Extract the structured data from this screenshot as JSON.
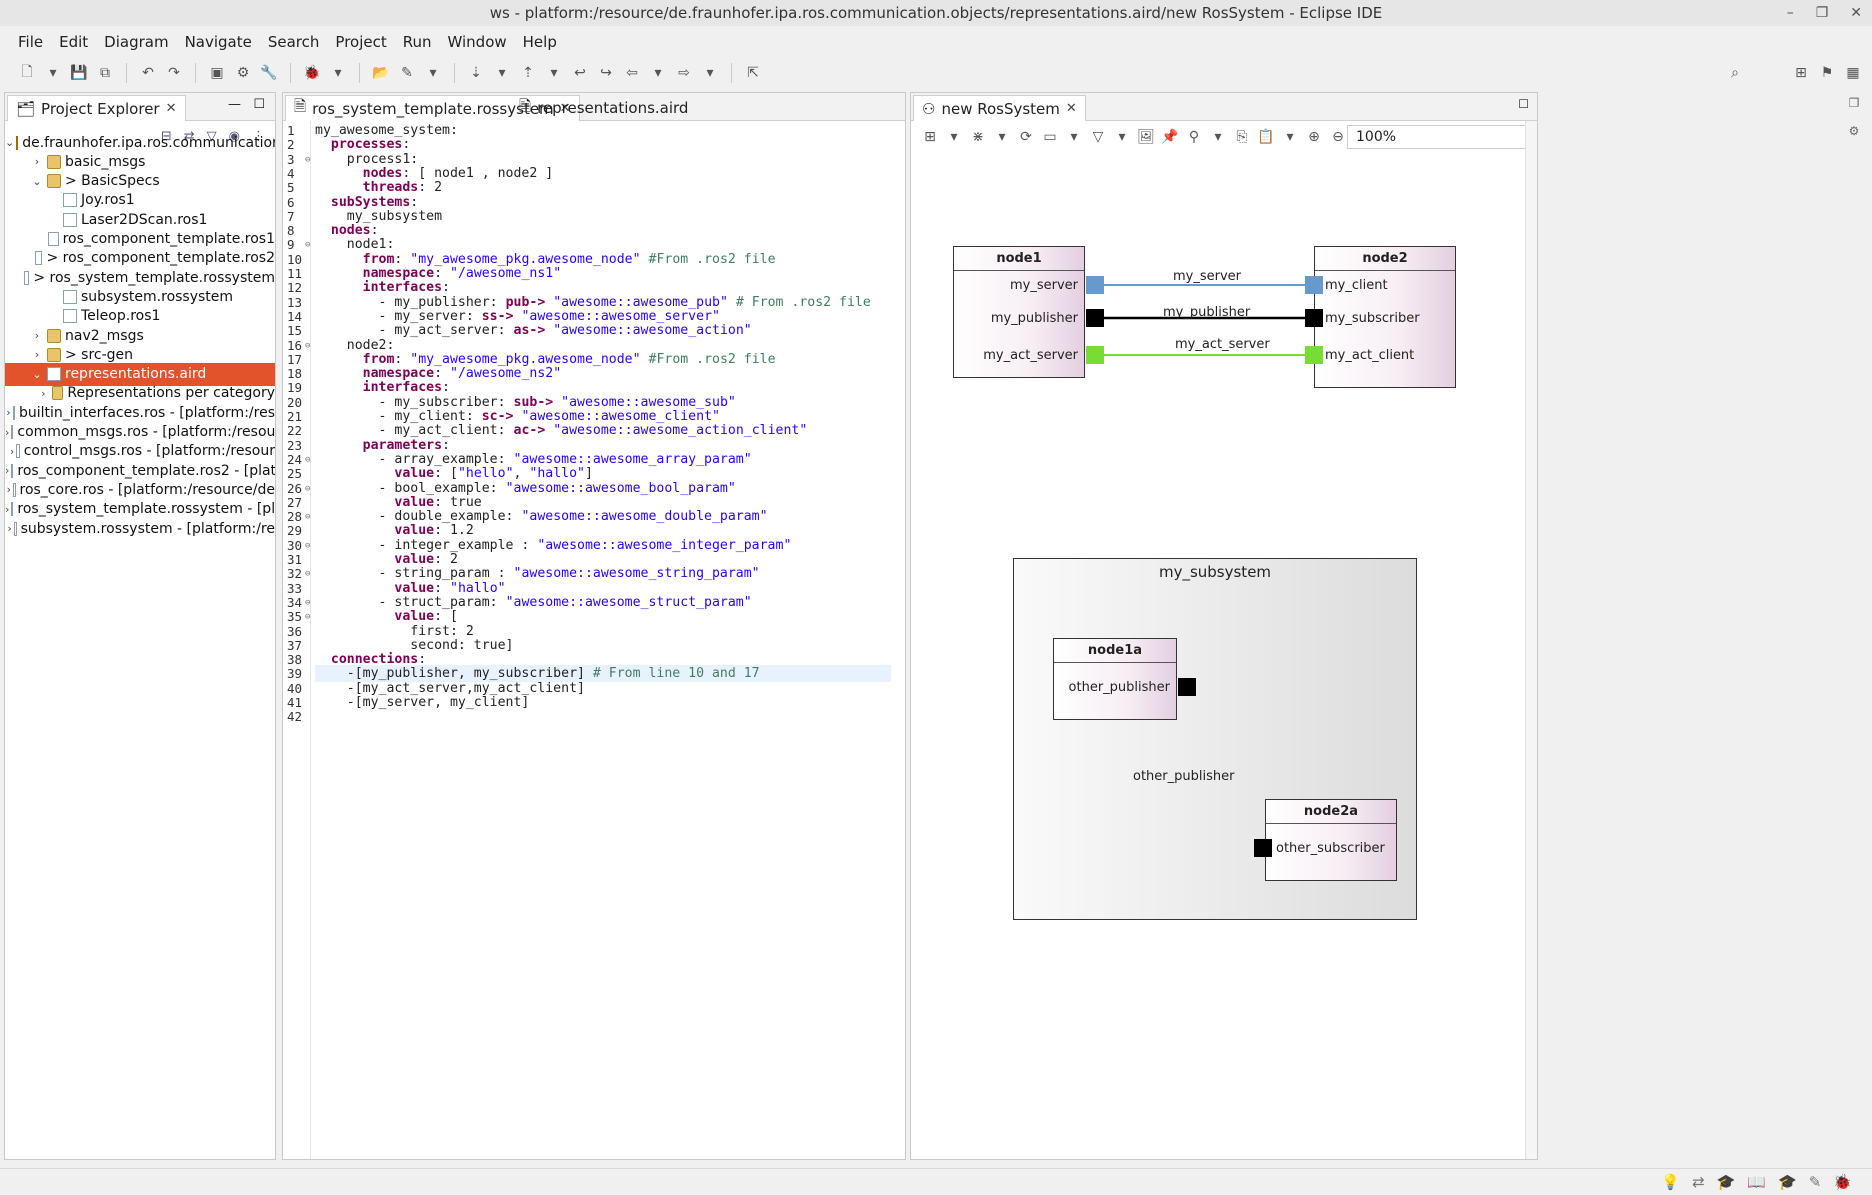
{
  "window": {
    "title": "ws - platform:/resource/de.fraunhofer.ipa.ros.communication.objects/representations.aird/new RosSystem - Eclipse IDE"
  },
  "menu": [
    "File",
    "Edit",
    "Diagram",
    "Navigate",
    "Search",
    "Project",
    "Run",
    "Window",
    "Help"
  ],
  "explorer": {
    "title": "Project Explorer",
    "items": [
      {
        "label": "de.fraunhofer.ipa.ros.communication.ob",
        "depth": 0,
        "twisty": "open",
        "icon": "proj"
      },
      {
        "label": "basic_msgs",
        "depth": 1,
        "twisty": "closed",
        "icon": "folder"
      },
      {
        "label": "> BasicSpecs",
        "depth": 1,
        "twisty": "open",
        "icon": "folder"
      },
      {
        "label": "Joy.ros1",
        "depth": 2,
        "twisty": "",
        "icon": "file"
      },
      {
        "label": "Laser2DScan.ros1",
        "depth": 2,
        "twisty": "",
        "icon": "file"
      },
      {
        "label": "ros_component_template.ros1",
        "depth": 2,
        "twisty": "",
        "icon": "file"
      },
      {
        "label": "> ros_component_template.ros2",
        "depth": 2,
        "twisty": "",
        "icon": "file"
      },
      {
        "label": "> ros_system_template.rossystem",
        "depth": 2,
        "twisty": "",
        "icon": "file"
      },
      {
        "label": "subsystem.rossystem",
        "depth": 2,
        "twisty": "",
        "icon": "file"
      },
      {
        "label": "Teleop.ros1",
        "depth": 2,
        "twisty": "",
        "icon": "file"
      },
      {
        "label": "nav2_msgs",
        "depth": 1,
        "twisty": "closed",
        "icon": "folder"
      },
      {
        "label": "> src-gen",
        "depth": 1,
        "twisty": "closed",
        "icon": "folder"
      },
      {
        "label": "representations.aird",
        "depth": 1,
        "twisty": "open",
        "icon": "file",
        "selected": true
      },
      {
        "label": "Representations per category",
        "depth": 2,
        "twisty": "closed",
        "icon": "folder"
      },
      {
        "label": "builtin_interfaces.ros - [platform:/res",
        "depth": 2,
        "twisty": "closed",
        "icon": "file"
      },
      {
        "label": "common_msgs.ros - [platform:/resou",
        "depth": 2,
        "twisty": "closed",
        "icon": "file"
      },
      {
        "label": "control_msgs.ros - [platform:/resour",
        "depth": 2,
        "twisty": "closed",
        "icon": "file"
      },
      {
        "label": "ros_component_template.ros2 - [plat",
        "depth": 2,
        "twisty": "closed",
        "icon": "file"
      },
      {
        "label": "ros_core.ros - [platform:/resource/de",
        "depth": 2,
        "twisty": "closed",
        "icon": "file"
      },
      {
        "label": "ros_system_template.rossystem - [pl",
        "depth": 2,
        "twisty": "closed",
        "icon": "file"
      },
      {
        "label": "subsystem.rossystem - [platform:/re",
        "depth": 2,
        "twisty": "closed",
        "icon": "file"
      }
    ]
  },
  "editor": {
    "tabs": [
      "ros_system_template.rossystem",
      "representations.aird"
    ],
    "lines": [
      "my_awesome_system:",
      "  processes:",
      "    process1:",
      "      nodes: [ node1 , node2 ]",
      "      threads: 2",
      "  subSystems:",
      "    my_subsystem",
      "  nodes:",
      "    node1:",
      "      from: \"my_awesome_pkg.awesome_node\" #From .ros2 file",
      "      namespace: \"/awesome_ns1\"",
      "      interfaces:",
      "        - my_publisher: pub-> \"awesome::awesome_pub\" # From .ros2 file",
      "        - my_server: ss-> \"awesome::awesome_server\"",
      "        - my_act_server: as-> \"awesome::awesome_action\"",
      "    node2:",
      "      from: \"my_awesome_pkg.awesome_node\" #From .ros2 file",
      "      namespace: \"/awesome_ns2\"",
      "      interfaces:",
      "        - my_subscriber: sub-> \"awesome::awesome_sub\"",
      "        - my_client: sc-> \"awesome::awesome_client\"",
      "        - my_act_client: ac-> \"awesome::awesome_action_client\"",
      "      parameters:",
      "        - array_example: \"awesome::awesome_array_param\"",
      "          value: [\"hello\", \"hallo\"]",
      "        - bool_example: \"awesome::awesome_bool_param\"",
      "          value: true",
      "        - double_example: \"awesome::awesome_double_param\"",
      "          value: 1.2",
      "        - integer_example : \"awesome::awesome_integer_param\"",
      "          value: 2",
      "        - string_param : \"awesome::awesome_string_param\"",
      "          value: \"hallo\"",
      "        - struct_param: \"awesome::awesome_struct_param\"",
      "          value: [",
      "            first: 2",
      "            second: true]",
      "  connections:",
      "    -[my_publisher, my_subscriber] # From line 10 and 17",
      "    -[my_act_server,my_act_client]",
      "    -[my_server, my_client]",
      ""
    ]
  },
  "diagram": {
    "tab": "new RosSystem",
    "zoom": "100%",
    "nodes": {
      "node1": {
        "title": "node1",
        "ports": [
          "my_server",
          "my_publisher",
          "my_act_server"
        ]
      },
      "node2": {
        "title": "node2",
        "ports": [
          "my_client",
          "my_subscriber",
          "my_act_client"
        ]
      }
    },
    "edges": [
      "my_server",
      "my_publisher",
      "my_act_server"
    ],
    "subsystem": {
      "title": "my_subsystem",
      "node1a": {
        "title": "node1a",
        "port": "other_publisher"
      },
      "node2a": {
        "title": "node2a",
        "port": "other_subscriber"
      },
      "edge": "other_publisher"
    },
    "colors": {
      "server": "#6699cc",
      "publisher": "#000000",
      "action": "#77dd33"
    }
  }
}
